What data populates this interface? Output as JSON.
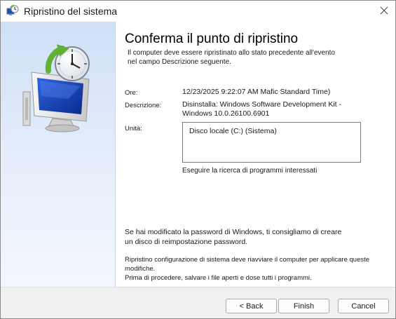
{
  "window": {
    "title": "Ripristino del sistema"
  },
  "content": {
    "heading": "Conferma il punto di ripristino",
    "intro_line1": "Il computer deve essere ripristinato allo stato precedente all'evento",
    "intro_line2": "nel campo Descrizione seguente.",
    "time_label": "Ore:",
    "time_value": "12/23/2025 9:22:07 AM Mafic Standard Time)",
    "description_label": "Descrizione:",
    "description_line1": "Disinstalla: Windows Software Development Kit -",
    "description_line2": "Windows 10.0.26100.6901",
    "drives_label": "Unità:",
    "drives": [
      "Disco locale (C:) (Sistema)"
    ],
    "scan_link": "Eseguire la ricerca di programmi interessati",
    "password_line1": "Se hai modificato la password di Windows, ti consigliamo di creare",
    "password_line2": "un disco di reimpostazione password.",
    "restart_line1": "Ripristino configurazione di sistema deve riavviare il computer per applicare queste modifiche.",
    "restart_line2": "Prima di procedere, salvare i file aperti e dose tutti i programmi."
  },
  "footer": {
    "back_label": "< Back",
    "finish_label": "Finish",
    "cancel_label": "Cancel"
  },
  "colors": {
    "accent": "#0067c0",
    "sidebar_top": "#cfe0f6",
    "clock_arrow": "#5fb236"
  }
}
